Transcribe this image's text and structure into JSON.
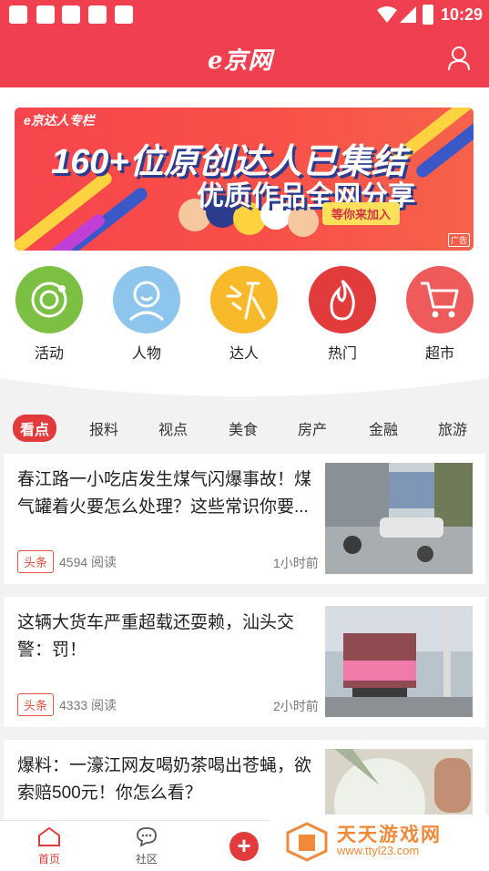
{
  "status_bar": {
    "time": "10:29"
  },
  "header": {
    "logo": "e京网"
  },
  "banner": {
    "tag": "e京达人专栏",
    "line1": "160+位原创达人已集结",
    "line2": "优质作品全网分享",
    "cta": "等你来加入",
    "ad_label": "广告"
  },
  "categories": [
    {
      "label": "活动",
      "color": "#7bc043",
      "icon": "orbit-icon"
    },
    {
      "label": "人物",
      "color": "#8ec5ec",
      "icon": "person-face-icon"
    },
    {
      "label": "达人",
      "color": "#f8b92b",
      "icon": "da-ren-icon"
    },
    {
      "label": "热门",
      "color": "#e23b3b",
      "icon": "flame-icon"
    },
    {
      "label": "超市",
      "color": "#ef5a5a",
      "icon": "cart-icon"
    }
  ],
  "tabs": [
    "看点",
    "报料",
    "视点",
    "美食",
    "房产",
    "金融",
    "旅游"
  ],
  "news": [
    {
      "title": "春江路一小吃店发生煤气闪爆事故！煤气罐着火要怎么处理？这些常识你要...",
      "badge": "头条",
      "reads": "4594 阅读",
      "time": "1小时前"
    },
    {
      "title": "这辆大货车严重超载还耍赖，汕头交警：罚！",
      "badge": "头条",
      "reads": "4333 阅读",
      "time": "2小时前"
    },
    {
      "title": "爆料：一濠江网友喝奶茶喝出苍蝇，欲索赔500元！你怎么看？",
      "badge": "",
      "reads": "",
      "time": ""
    }
  ],
  "bottom_nav": {
    "home": "首页",
    "community": "社区",
    "plus": "+"
  },
  "watermark": {
    "name": "天天游戏网",
    "url": "www.ttyl23.com"
  }
}
